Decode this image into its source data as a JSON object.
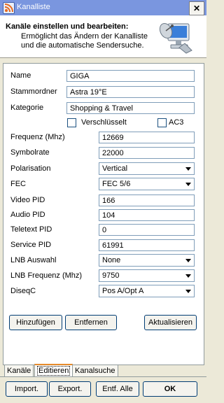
{
  "window": {
    "title": "Kanalliste",
    "close_label": "✕"
  },
  "header": {
    "title": "Kanäle einstellen und bearbeiten:",
    "subtitle_line1": "Ermöglicht das Ändern der Kanalliste",
    "subtitle_line2": "und die automatische Sendersuche.",
    "icon": "computer-satellite-icon"
  },
  "form": {
    "name": {
      "label": "Name",
      "value": "GIGA"
    },
    "stammordner": {
      "label": "Stammordner",
      "value": "Astra 19°E"
    },
    "kategorie": {
      "label": "Kategorie",
      "value": "Shopping & Travel"
    },
    "verschluesselt": {
      "label": "Verschlüsselt",
      "checked": false
    },
    "ac3": {
      "label": "AC3",
      "checked": false
    },
    "frequenz": {
      "label": "Frequenz (Mhz)",
      "value": "12669"
    },
    "symbolrate": {
      "label": "Symbolrate",
      "value": "22000"
    },
    "polarisation": {
      "label": "Polarisation",
      "value": "Vertical"
    },
    "fec": {
      "label": "FEC",
      "value": "FEC 5/6"
    },
    "video_pid": {
      "label": "Video PID",
      "value": "166"
    },
    "audio_pid": {
      "label": "Audio PID",
      "value": "104"
    },
    "teletext_pid": {
      "label": "Teletext PID",
      "value": "0"
    },
    "service_pid": {
      "label": "Service PID",
      "value": "61991"
    },
    "lnb_auswahl": {
      "label": "LNB Auswahl",
      "value": "None"
    },
    "lnb_frequenz": {
      "label": "LNB Frequenz (Mhz)",
      "value": "9750"
    },
    "diseqc": {
      "label": "DiseqC",
      "value": "Pos A/Opt A"
    }
  },
  "actions": {
    "add": "Hinzufügen",
    "remove": "Entfernen",
    "update": "Aktualisieren"
  },
  "tabs": [
    {
      "label": "Kanäle",
      "active": false
    },
    {
      "label": "Editieren",
      "active": true
    },
    {
      "label": "Kanalsuche",
      "active": false
    }
  ],
  "footer": {
    "import": "Import.",
    "export": "Export.",
    "delete_all": "Entf. Alle",
    "ok": "OK"
  },
  "colors": {
    "titlebar": "#7a96df",
    "background": "#ece9d8",
    "tab_accent": "#e68b2c"
  }
}
